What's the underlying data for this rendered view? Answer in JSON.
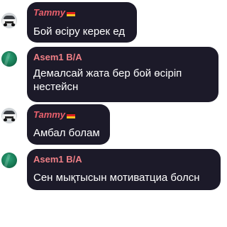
{
  "messages": [
    {
      "author": "Tammy",
      "flag_icon": "germany-flag-icon",
      "text": "Бой өсіру керек ед"
    },
    {
      "author": "Asem1 B/A",
      "text": "Демалсай жата бер бой өсіріп нестейсн"
    },
    {
      "author": "Tammy",
      "flag_icon": "germany-flag-icon",
      "text": "Амбал болам"
    },
    {
      "author": "Asem1 B/A",
      "text": "Сен мықтысын мотиватциа болсн"
    }
  ],
  "colors": {
    "bubble_bg": "#1c1a29",
    "name_color": "#ef7f86",
    "text_color": "#ffffff"
  }
}
